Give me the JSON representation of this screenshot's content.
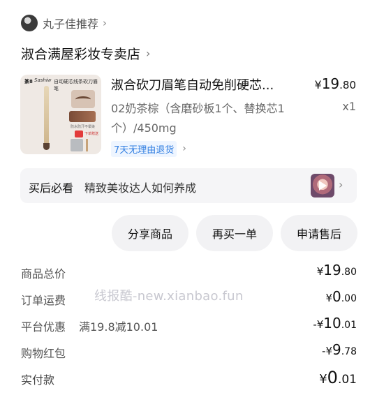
{
  "recommender": {
    "name": "丸子佳推荐",
    "chevron": "›"
  },
  "shop": {
    "name": "淑合满屋彩妆专卖店",
    "chevron": "›"
  },
  "product": {
    "thumbnail": {
      "logo": "篆8",
      "brand": "Sashiw",
      "headline": "自动硬芯线条砍刀眉笔",
      "small_text": "防水防汗不晕染",
      "gift_text": "下单赠送"
    },
    "title": "淑合砍刀眉笔自动免削硬芯...",
    "price": {
      "currency": "¥",
      "int": "19",
      "dec": ".80"
    },
    "variant": "02奶茶棕（含磨砂板1个、替换芯1个）/450mg",
    "quantity": "x1",
    "badge": {
      "text": "7天无理由退货",
      "chevron": "›"
    }
  },
  "guide": {
    "label": "买后必看",
    "text": "精致美妆达人如何养成",
    "chevron": "›"
  },
  "actions": {
    "share": "分享商品",
    "rebuy": "再买一单",
    "after_sale": "申请售后"
  },
  "summary": {
    "total": {
      "label": "商品总价",
      "currency": "¥",
      "int": "19",
      "dec": ".80"
    },
    "shipping": {
      "label": "订单运费",
      "currency": "¥",
      "int": "0",
      "dec": ".00"
    },
    "platform": {
      "label": "平台优惠",
      "extra": "满19.8减10.01",
      "currency": "-¥",
      "int": "10",
      "dec": ".01"
    },
    "red_packet": {
      "label": "购物红包",
      "currency": "-¥",
      "int": "9",
      "dec": ".78"
    },
    "paid": {
      "label": "实付款",
      "currency": "¥",
      "int": "0",
      "dec": ".01"
    }
  },
  "watermark": "线报酷-new.xianbao.fun"
}
